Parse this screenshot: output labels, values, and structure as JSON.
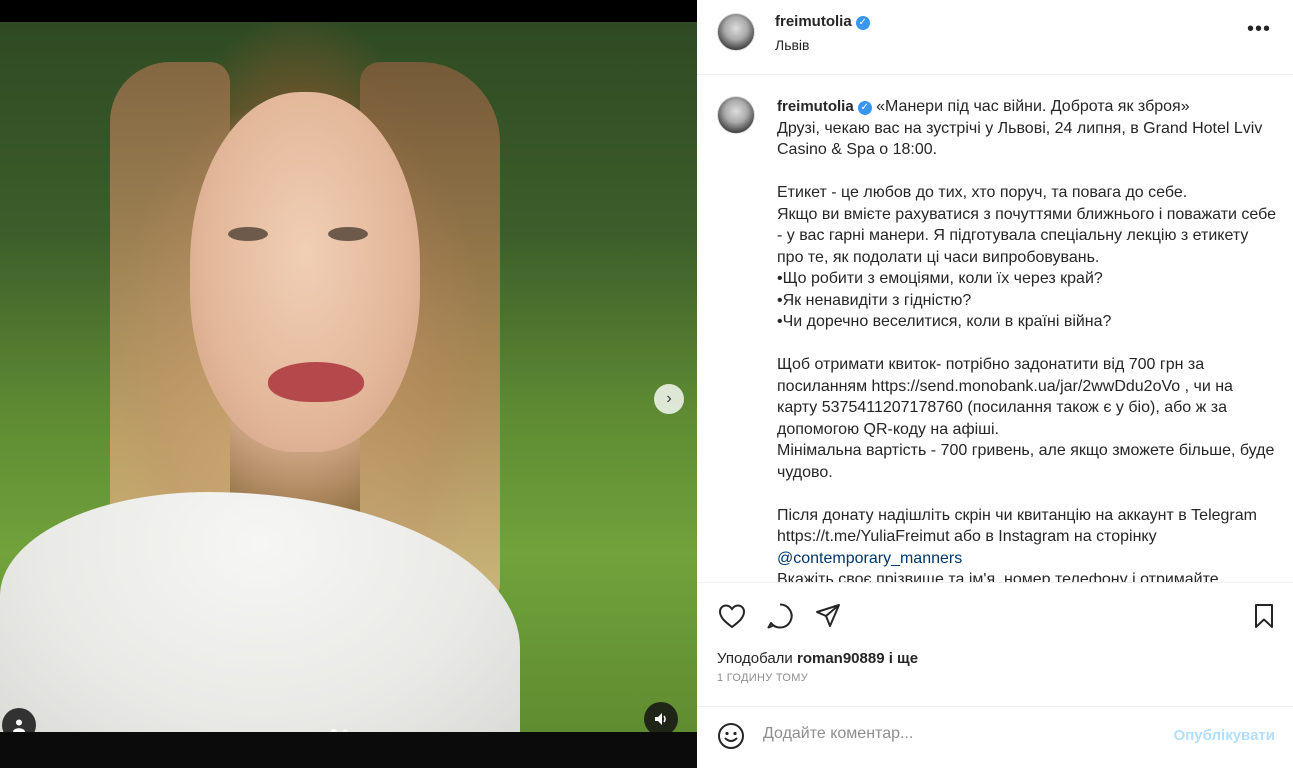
{
  "post": {
    "username": "freimutolia",
    "location": "Львів",
    "more_label": "•••"
  },
  "caption": {
    "username": "freimutolia",
    "body_before_mention": " «Манери під час війни. Доброта як зброя»\nДрузі, чекаю вас на зустрічі у Львові, 24 липня, в Grand Hotel Lviv Casino & Spa о 18:00.\n\nЕтикет - це любов до тих, хто поруч, та повага до себе.\nЯкщо ви вмієте рахуватися з почуттями ближнього і поважати себе - у вас гарні манери. Я підготувала спеціальну лекцію з етикету про те, як подолати ці часи випробовувань.\n•Що робити з емоціями, коли їх через край?\n•Як ненавидіти з гідністю?\n•Чи доречно веселитися, коли в країні війна?\n\nЩоб отримати квиток- потрібно задонатити від 700 грн за посиланням https://send.monobank.ua/jar/2wwDdu2oVo , чи на карту 5375411207178760 (посилання також є у біо), або ж за допомогою QR-коду на афіші.\nМінімальна вартість - 700 гривень, але якщо зможете більше, буде чудово.\n\nПісля донату надішліть скрін чи квитанцію на аккаунт в Telegram https://t.me/YuliaFreimut або в Instagram на сторінку ",
    "mention": "@contemporary_manners",
    "body_after_mention": "\nВкажіть своє прізвище та ім'я, номер телефону і отримайте"
  },
  "actions": {
    "like_icon": "heart-icon",
    "comment_icon": "comment-icon",
    "share_icon": "share-icon",
    "save_icon": "bookmark-icon"
  },
  "likes": {
    "prefix": "Уподобали ",
    "user": "roman90889",
    "suffix": " і ще"
  },
  "timestamp": "1 ГОДИНУ ТОМУ",
  "comment_box": {
    "placeholder": "Додайте коментар...",
    "publish_label": "Опублікувати"
  },
  "media": {
    "next_arrow": "›",
    "carousel_dots": 2,
    "active_dot": 0
  },
  "colors": {
    "verified": "#3897f0",
    "mention": "#00376b",
    "publish_disabled": "#b2dffc"
  }
}
